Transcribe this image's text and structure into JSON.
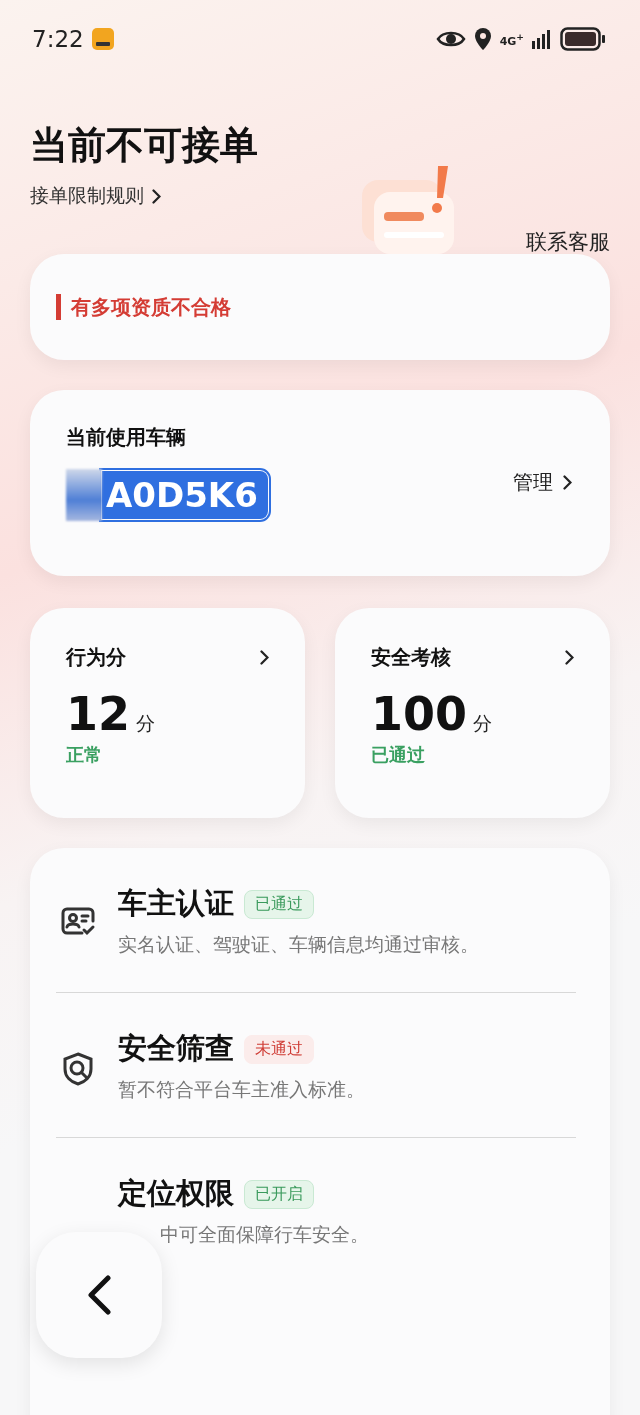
{
  "status_bar": {
    "time": "7:22",
    "network": "4G$^{+}$"
  },
  "header": {
    "title": "当前不可接单",
    "rules_link": "接单限制规则",
    "support_link": "联系客服"
  },
  "alert": {
    "text": "有多项资质不合格"
  },
  "vehicle": {
    "label": "当前使用车辆",
    "plate": "A0D5K6",
    "manage": "管理"
  },
  "scores": [
    {
      "title": "行为分",
      "value": "12",
      "unit": "分",
      "status": "正常"
    },
    {
      "title": "安全考核",
      "value": "100",
      "unit": "分",
      "status": "已通过"
    }
  ],
  "checks": [
    {
      "kind": "id-card",
      "title": "车主认证",
      "tag": "已通过",
      "passed": true,
      "description": "实名认证、驾驶证、车辆信息均通过审核。"
    },
    {
      "kind": "shield-search",
      "title": "安全筛查",
      "tag": "未通过",
      "passed": false,
      "description": "暂不符合平台车主准入标准。"
    },
    {
      "kind": "covered",
      "title": "定位权限",
      "tag": "已开启",
      "passed": true,
      "description": "中可全面保障行车安全。"
    }
  ]
}
